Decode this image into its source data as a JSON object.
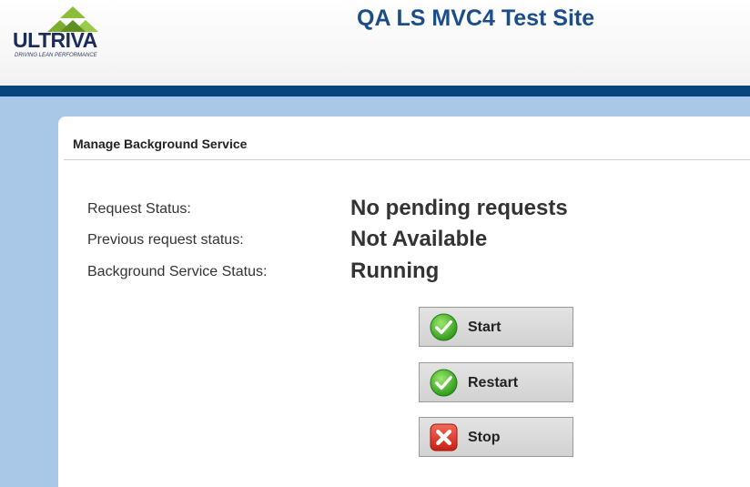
{
  "header": {
    "logo_text": "ULTRIVA",
    "logo_tagline": "DRIVING LEAN PERFORMANCE",
    "site_title": "QA LS MVC4 Test Site"
  },
  "panel": {
    "title": "Manage Background Service",
    "rows": [
      {
        "label": "Request Status:",
        "value": "No pending requests"
      },
      {
        "label": "Previous request status:",
        "value": "Not Available"
      },
      {
        "label": "Background Service Status:",
        "value": "Running"
      }
    ],
    "buttons": [
      {
        "label": "Start",
        "icon": "green-check-icon"
      },
      {
        "label": "Restart",
        "icon": "green-check-icon"
      },
      {
        "label": "Stop",
        "icon": "red-x-icon"
      }
    ]
  },
  "colors": {
    "nav_bar": "#08457e",
    "page_background": "#a9c7e6",
    "title_blue": "#1b4e89",
    "logo_green": "#7dac2e"
  }
}
